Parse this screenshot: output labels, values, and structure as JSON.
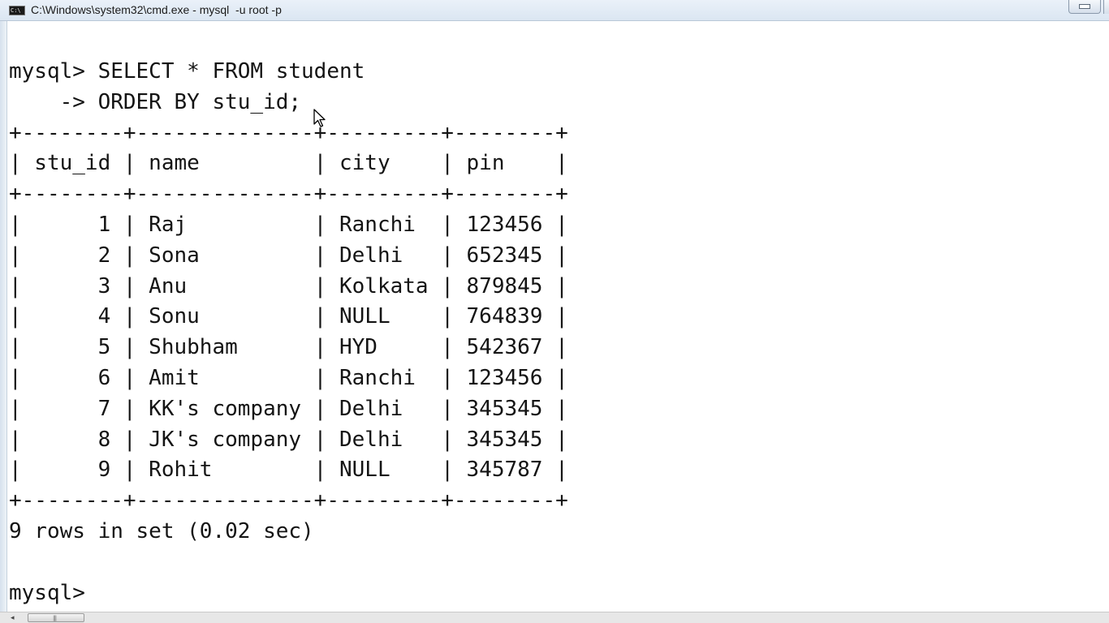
{
  "window": {
    "icon_text": "C:\\",
    "title": "C:\\Windows\\system32\\cmd.exe - mysql  -u root -p"
  },
  "console": {
    "query_line1": "mysql> SELECT * FROM student",
    "query_line2": "    -> ORDER BY stu_id;",
    "border": "+--------+--------------+---------+--------+",
    "header": "| stu_id | name         | city    | pin    |",
    "columns": [
      "stu_id",
      "name",
      "city",
      "pin"
    ],
    "rows": [
      {
        "stu_id": "1",
        "name": "Raj",
        "city": "Ranchi",
        "pin": "123456",
        "line": "|      1 | Raj          | Ranchi  | 123456 |"
      },
      {
        "stu_id": "2",
        "name": "Sona",
        "city": "Delhi",
        "pin": "652345",
        "line": "|      2 | Sona         | Delhi   | 652345 |"
      },
      {
        "stu_id": "3",
        "name": "Anu",
        "city": "Kolkata",
        "pin": "879845",
        "line": "|      3 | Anu          | Kolkata | 879845 |"
      },
      {
        "stu_id": "4",
        "name": "Sonu",
        "city": "NULL",
        "pin": "764839",
        "line": "|      4 | Sonu         | NULL    | 764839 |"
      },
      {
        "stu_id": "5",
        "name": "Shubham",
        "city": "HYD",
        "pin": "542367",
        "line": "|      5 | Shubham      | HYD     | 542367 |"
      },
      {
        "stu_id": "6",
        "name": "Amit",
        "city": "Ranchi",
        "pin": "123456",
        "line": "|      6 | Amit         | Ranchi  | 123456 |"
      },
      {
        "stu_id": "7",
        "name": "KK's company",
        "city": "Delhi",
        "pin": "345345",
        "line": "|      7 | KK's company | Delhi   | 345345 |"
      },
      {
        "stu_id": "8",
        "name": "JK's company",
        "city": "Delhi",
        "pin": "345345",
        "line": "|      8 | JK's company | Delhi   | 345345 |"
      },
      {
        "stu_id": "9",
        "name": "Rohit",
        "city": "NULL",
        "pin": "345787",
        "line": "|      9 | Rohit        | NULL    | 345787 |"
      }
    ],
    "summary": "9 rows in set (0.02 sec)",
    "prompt": "mysql> "
  },
  "scrollbar": {
    "left_arrow": "◂",
    "grip": "|||"
  },
  "colors": {
    "console_bg": "#ffffff",
    "console_text": "#141414",
    "titlebar": "#dbe6f2"
  }
}
